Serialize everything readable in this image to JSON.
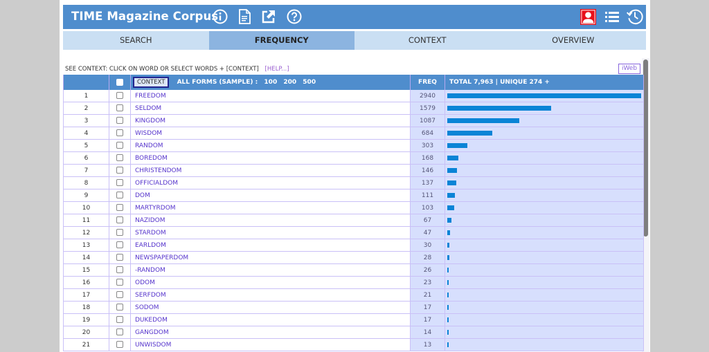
{
  "header": {
    "title": "TIME Magazine Corpus",
    "icons_left": [
      "info-icon",
      "document-icon",
      "external-link-icon",
      "help-icon"
    ],
    "icons_right": [
      "user-icon",
      "list-icon",
      "history-icon"
    ],
    "accent_color": "#4f8dcd",
    "user_icon_color": "#e8101a"
  },
  "tabs": [
    {
      "label": "SEARCH",
      "active": false
    },
    {
      "label": "FREQUENCY",
      "active": true
    },
    {
      "label": "CONTEXT",
      "active": false
    },
    {
      "label": "OVERVIEW",
      "active": false
    }
  ],
  "hint": {
    "text": "SEE CONTEXT: CLICK ON WORD OR SELECT WORDS + [CONTEXT]",
    "help_link": "[HELP...]"
  },
  "iweb_label": "iWeb",
  "table": {
    "context_button": "CONTEXT",
    "all_forms_label": "ALL FORMS  (SAMPLE) :",
    "sample_sizes": [
      "100",
      "200",
      "500"
    ],
    "freq_header": "FREQ",
    "total_label": "TOTAL 7,963  |  UNIQUE 274  +",
    "max_freq": 2940,
    "rows": [
      {
        "rank": "1",
        "word": "FREEDOM",
        "freq": 2940
      },
      {
        "rank": "2",
        "word": "SELDOM",
        "freq": 1579
      },
      {
        "rank": "3",
        "word": "KINGDOM",
        "freq": 1087
      },
      {
        "rank": "4",
        "word": "WISDOM",
        "freq": 684
      },
      {
        "rank": "5",
        "word": "RANDOM",
        "freq": 303
      },
      {
        "rank": "6",
        "word": "BOREDOM",
        "freq": 168
      },
      {
        "rank": "7",
        "word": "CHRISTENDOM",
        "freq": 146
      },
      {
        "rank": "8",
        "word": "OFFICIALDOM",
        "freq": 137
      },
      {
        "rank": "9",
        "word": "DOM",
        "freq": 111
      },
      {
        "rank": "10",
        "word": "MARTYRDOM",
        "freq": 103
      },
      {
        "rank": "11",
        "word": "NAZIDOM",
        "freq": 67
      },
      {
        "rank": "12",
        "word": "STARDOM",
        "freq": 47
      },
      {
        "rank": "13",
        "word": "EARLDOM",
        "freq": 30
      },
      {
        "rank": "14",
        "word": "NEWSPAPERDOM",
        "freq": 28
      },
      {
        "rank": "15",
        "word": "-RANDOM",
        "freq": 26
      },
      {
        "rank": "16",
        "word": "ODOM",
        "freq": 23
      },
      {
        "rank": "17",
        "word": "SERFDOM",
        "freq": 21
      },
      {
        "rank": "18",
        "word": "SODOM",
        "freq": 17
      },
      {
        "rank": "19",
        "word": "DUKEDOM",
        "freq": 17
      },
      {
        "rank": "20",
        "word": "GANGDOM",
        "freq": 14
      },
      {
        "rank": "21",
        "word": "UNWISDOM",
        "freq": 13
      }
    ]
  }
}
